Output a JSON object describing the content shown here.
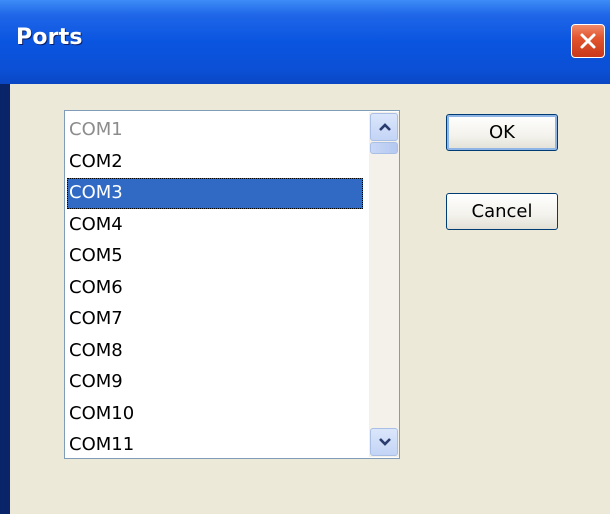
{
  "window": {
    "title": "Ports"
  },
  "ports_list": {
    "items": [
      {
        "label": "COM1",
        "state": "disabled"
      },
      {
        "label": "COM2",
        "state": "normal"
      },
      {
        "label": "COM3",
        "state": "selected"
      },
      {
        "label": "COM4",
        "state": "normal"
      },
      {
        "label": "COM5",
        "state": "normal"
      },
      {
        "label": "COM6",
        "state": "normal"
      },
      {
        "label": "COM7",
        "state": "normal"
      },
      {
        "label": "COM8",
        "state": "normal"
      },
      {
        "label": "COM9",
        "state": "normal"
      },
      {
        "label": "COM10",
        "state": "normal"
      },
      {
        "label": "COM11",
        "state": "normal"
      }
    ],
    "selected_index": 2
  },
  "buttons": {
    "ok_label": "OK",
    "cancel_label": "Cancel"
  },
  "icons": {
    "close": "close-icon",
    "scroll_up": "chevron-up-icon",
    "scroll_down": "chevron-down-icon"
  },
  "colors": {
    "titlebar": "#0a55e0",
    "selection": "#316ac5",
    "dialog_bg": "#ece9d8",
    "disabled_text": "#8c8c8c"
  }
}
